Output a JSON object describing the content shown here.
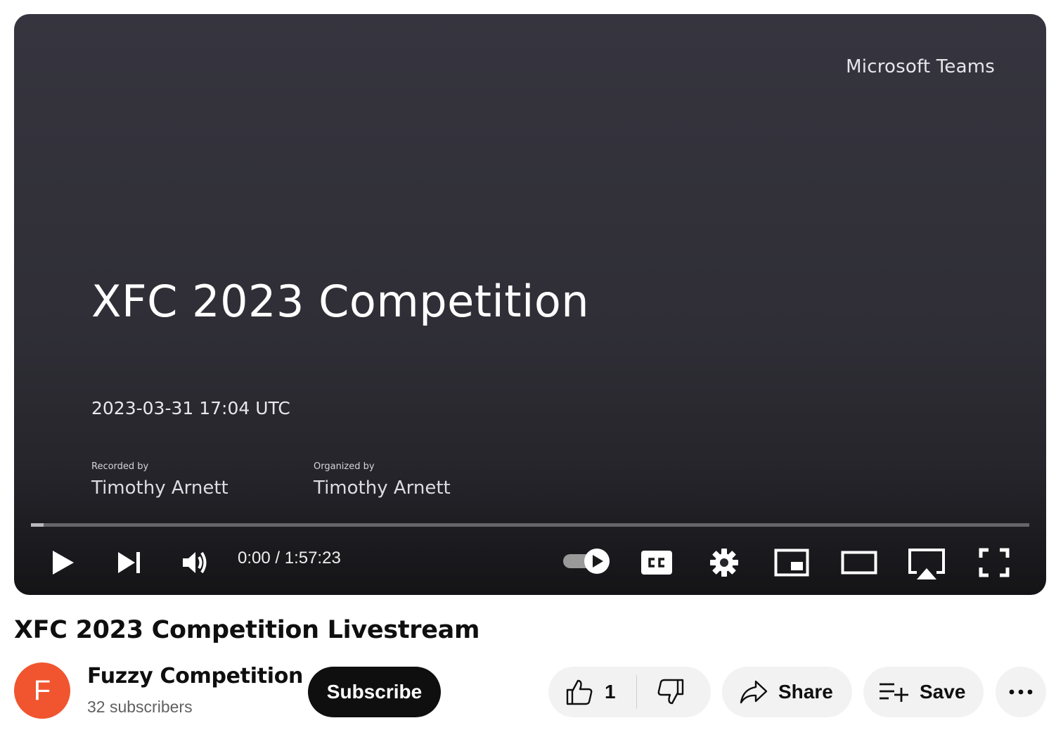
{
  "player": {
    "slide": {
      "brand": "Microsoft Teams",
      "title": "XFC 2023 Competition",
      "datetime": "2023-03-31 17:04 UTC",
      "recorded_label": "Recorded by",
      "recorded_name": "Timothy Arnett",
      "organized_label": "Organized by",
      "organized_name": "Timothy Arnett"
    },
    "time_display": "0:00 / 1:57:23",
    "progress_loaded_fraction": 0.013,
    "autoplay_on": true,
    "icons": {
      "play": "play-icon",
      "next": "next-icon",
      "volume": "volume-icon",
      "autoplay": "autoplay-toggle-icon",
      "captions": "captions-icon",
      "settings": "settings-gear-icon",
      "miniplayer": "miniplayer-icon",
      "theater": "theater-mode-icon",
      "airplay": "airplay-icon",
      "fullscreen": "fullscreen-icon"
    }
  },
  "video": {
    "title": "XFC 2023 Competition Livestream"
  },
  "channel": {
    "avatar_letter": "F",
    "avatar_color": "#f0552f",
    "name": "Fuzzy Competition",
    "subscribers": "32 subscribers",
    "subscribe_label": "Subscribe"
  },
  "actions": {
    "like_count": "1",
    "share_label": "Share",
    "save_label": "Save",
    "more_label": "..."
  }
}
